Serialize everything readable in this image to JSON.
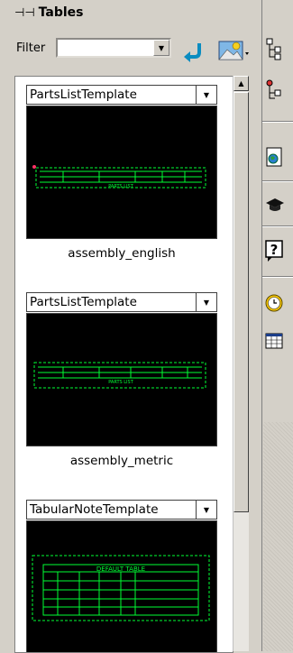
{
  "panel": {
    "title": "Tables",
    "pin_icon": "pin-icon"
  },
  "filter": {
    "label": "Filter",
    "value": ""
  },
  "toolbar": {
    "apply_icon": "return-arrow-icon",
    "image_icon": "picture-icon"
  },
  "templates": [
    {
      "template": "PartsListTemplate",
      "caption": "assembly_english",
      "table_title": "PARTS LIST"
    },
    {
      "template": "PartsListTemplate",
      "caption": "assembly_metric",
      "table_title": "PARTS LIST"
    },
    {
      "template": "TabularNoteTemplate",
      "caption": "",
      "table_title": "DEFAULT TABLE"
    }
  ],
  "right_toolbar": [
    "hierarchy-icon",
    "tree-icon",
    "globe-document-icon",
    "graduation-cap-icon",
    "help-icon",
    "clock-icon",
    "table-icon"
  ],
  "colors": {
    "thumbnail_bg": "#000000",
    "drawing_green": "#00ff33",
    "panel_bg": "#d4d0c8"
  }
}
